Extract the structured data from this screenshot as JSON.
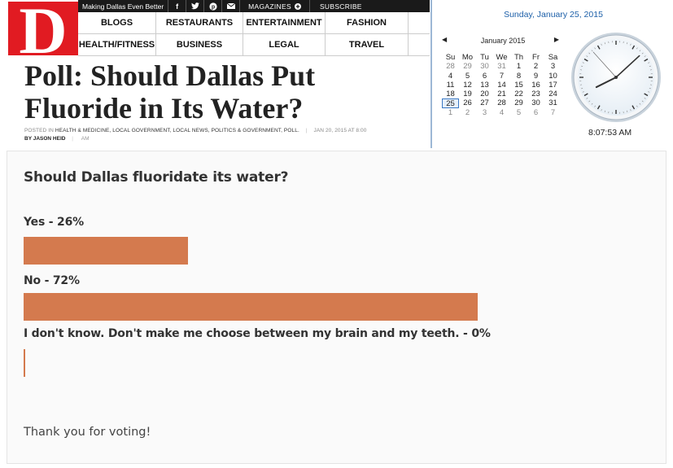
{
  "site": {
    "logo_letter": "D",
    "tagline": "Making Dallas Even Better",
    "social": [
      {
        "icon": "facebook-icon",
        "glyph": "f"
      },
      {
        "icon": "twitter-icon",
        "glyph": "▾"
      },
      {
        "icon": "pinterest-icon",
        "glyph": "℗"
      },
      {
        "icon": "email-icon",
        "glyph": "✉"
      }
    ],
    "magazines_label": "MAGAZINES",
    "subscribe_label": "SUBSCRIBE",
    "nav_row1": [
      "BLOGS",
      "RESTAURANTS",
      "ENTERTAINMENT",
      "FASHION"
    ],
    "nav_row2": [
      "HEALTH/FITNESS",
      "BUSINESS",
      "LEGAL",
      "TRAVEL"
    ]
  },
  "article": {
    "title": "Poll: Should Dallas Put Fluoride in Its Water?",
    "posted_in_prefix": "POSTED IN",
    "categories": "HEALTH & MEDICINE, LOCAL GOVERNMENT, LOCAL NEWS, POLITICS & GOVERNMENT, POLL.",
    "date": "JAN 20, 2015 AT 8:00",
    "byline": "BY JASON HEID",
    "time_suffix": "AM"
  },
  "clock": {
    "full_date": "Sunday, January 25, 2015",
    "month_label": "January 2015",
    "weekdays": [
      "Su",
      "Mo",
      "Tu",
      "We",
      "Th",
      "Fr",
      "Sa"
    ],
    "weeks": [
      [
        "28",
        "29",
        "30",
        "31",
        "1",
        "2",
        "3"
      ],
      [
        "4",
        "5",
        "6",
        "7",
        "8",
        "9",
        "10"
      ],
      [
        "11",
        "12",
        "13",
        "14",
        "15",
        "16",
        "17"
      ],
      [
        "18",
        "19",
        "20",
        "21",
        "22",
        "23",
        "24"
      ],
      [
        "25",
        "26",
        "27",
        "28",
        "29",
        "30",
        "31"
      ],
      [
        "1",
        "2",
        "3",
        "4",
        "5",
        "6",
        "7"
      ]
    ],
    "today": "25",
    "time": "8:07:53 AM"
  },
  "poll": {
    "question": "Should Dallas fluoridate its water?",
    "bar_color": "#d47a4e",
    "options": [
      {
        "label": "Yes - 26%",
        "percent": 26
      },
      {
        "label": "No - 72%",
        "percent": 72
      },
      {
        "label": "I don't know. Don't make me choose between my brain and my teeth. - 0%",
        "percent": 0
      }
    ],
    "thanks": "Thank you for voting!"
  }
}
